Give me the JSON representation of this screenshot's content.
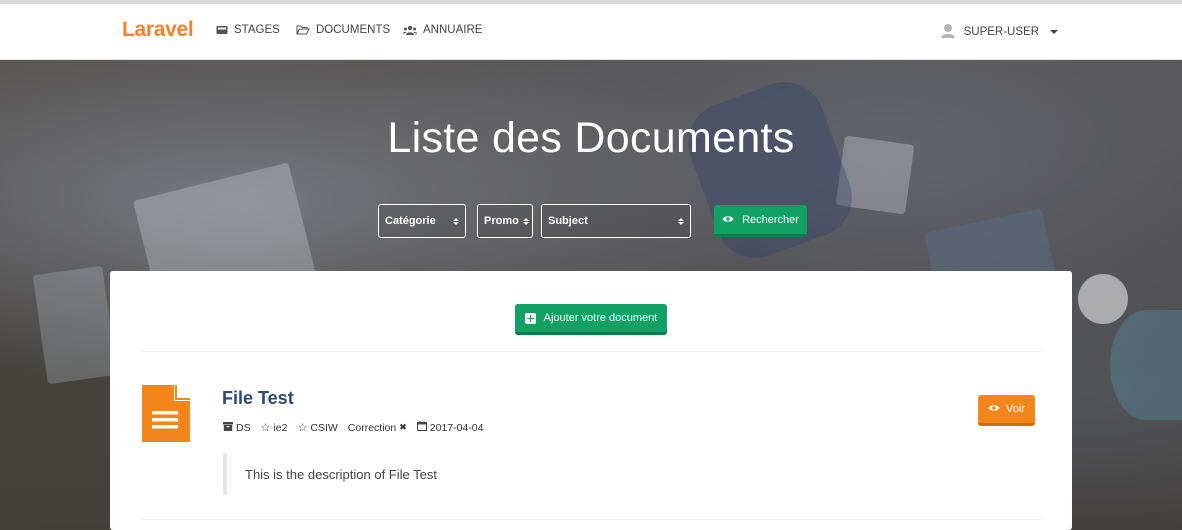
{
  "navbar": {
    "brand": "Laravel",
    "items": [
      {
        "label": "STAGES",
        "icon": "inbox-icon"
      },
      {
        "label": "DOCUMENTS",
        "icon": "folder-open-icon"
      },
      {
        "label": "ANNUAIRE",
        "icon": "users-icon"
      }
    ],
    "user": {
      "label": "SUPER-USER",
      "icon": "user-avatar-icon"
    }
  },
  "hero": {
    "title": "Liste des Documents",
    "filters": {
      "categorie": "Catégorie",
      "promo": "Promo",
      "subject": "Subject"
    },
    "search_button": "Rechercher"
  },
  "content": {
    "add_button": "Ajouter votre document",
    "documents": [
      {
        "title": "File Test",
        "category": "DS",
        "promo": "ie2",
        "subject": "CSIW",
        "correction_label": "Correction",
        "correction_mark": "✖",
        "date": "2017-04-04",
        "description": "This is the description of File Test",
        "view_button": "Voir"
      }
    ]
  },
  "colors": {
    "brand": "#f4822a",
    "green": "#12a165",
    "orange": "#f2861a",
    "title": "#2b4a6f"
  }
}
